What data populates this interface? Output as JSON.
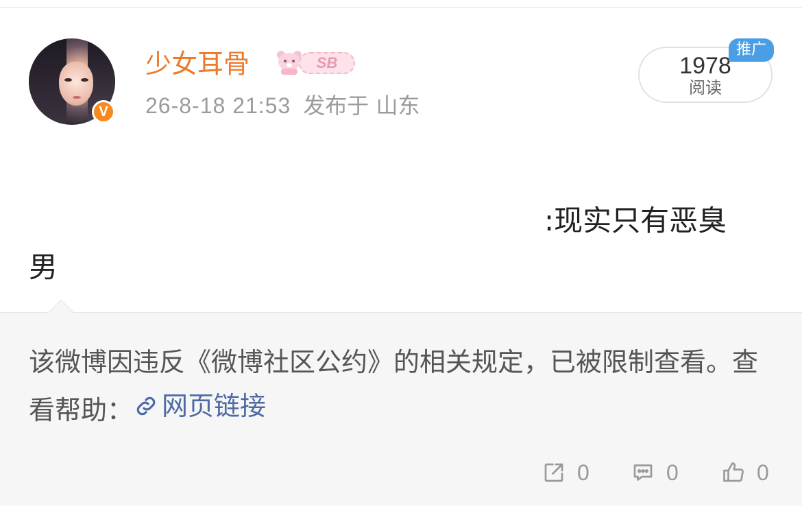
{
  "post": {
    "author": {
      "name": "少女耳骨",
      "badge_text": "SB",
      "verified_mark": "V"
    },
    "timestamp": "26-8-18 21:53",
    "location": "发布于 山东",
    "reads": {
      "count": "1978",
      "label": "阅读"
    },
    "promo_tag": "推广",
    "content": {
      "line1": ":现实只有恶臭",
      "line2": "男"
    }
  },
  "notice": {
    "text": "该微博因违反《微博社区公约》的相关规定，已被限制查看。查看帮助：",
    "link_label": "网页链接",
    "link_icon": "link-icon"
  },
  "actions": {
    "share_count": "0",
    "comment_count": "0",
    "like_count": "0"
  },
  "colors": {
    "username": "#ec7a2a",
    "verified": "#f78a1f",
    "promo": "#4a9ee6",
    "link": "#4d6aa6",
    "notice_bg": "#f6f6f6"
  }
}
